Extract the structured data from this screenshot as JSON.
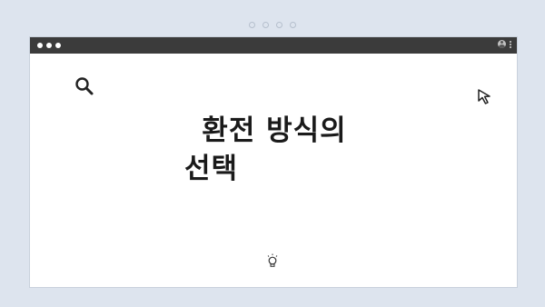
{
  "pager": {
    "count": 4
  },
  "window": {
    "titlebar": {
      "traffic_lights": 3,
      "icons": [
        "avatar-icon",
        "kebab-menu-icon"
      ]
    },
    "canvas": {
      "headline_line1": "환전 방식의",
      "headline_line2": "선택",
      "icons": [
        "search-icon",
        "cursor-icon",
        "lightbulb-icon"
      ]
    }
  }
}
